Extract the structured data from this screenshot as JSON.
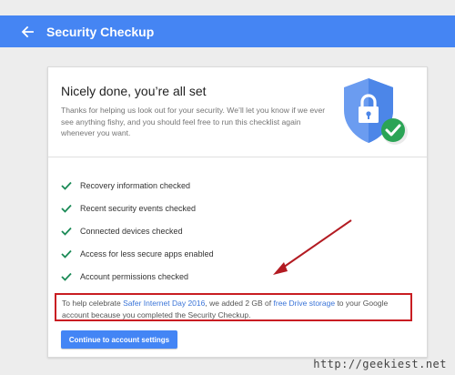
{
  "header": {
    "title": "Security Checkup",
    "back_icon": "arrow-back-icon",
    "color": "#4585f3"
  },
  "card": {
    "title": "Nicely done, you’re all set",
    "description": "Thanks for helping us look out for your security. We’ll let you know if we ever see anything fishy, and you should feel free to run this checklist again whenever you want.",
    "illustration": "shield-lock-check-icon"
  },
  "checklist": [
    {
      "label": "Recovery information checked",
      "icon": "check-icon"
    },
    {
      "label": "Recent security events checked",
      "icon": "check-icon"
    },
    {
      "label": "Connected devices checked",
      "icon": "check-icon"
    },
    {
      "label": "Access for less secure apps enabled",
      "icon": "check-icon"
    },
    {
      "label": "Account permissions checked",
      "icon": "check-icon"
    }
  ],
  "promo": {
    "text_before": "To help celebrate ",
    "link1": "Safer Internet Day 2016",
    "text_middle": ", we added 2 GB of ",
    "link2": "free Drive storage",
    "text_after": " to your Google account because you completed the Security Checkup."
  },
  "button": {
    "continue_label": "Continue to account settings"
  },
  "watermark": "http://geekiest.net",
  "colors": {
    "accent": "#4385f5",
    "check": "#1a8a56",
    "highlight_box": "#c91d22",
    "shield": "#4c86e8",
    "badge": "#2ba456"
  }
}
